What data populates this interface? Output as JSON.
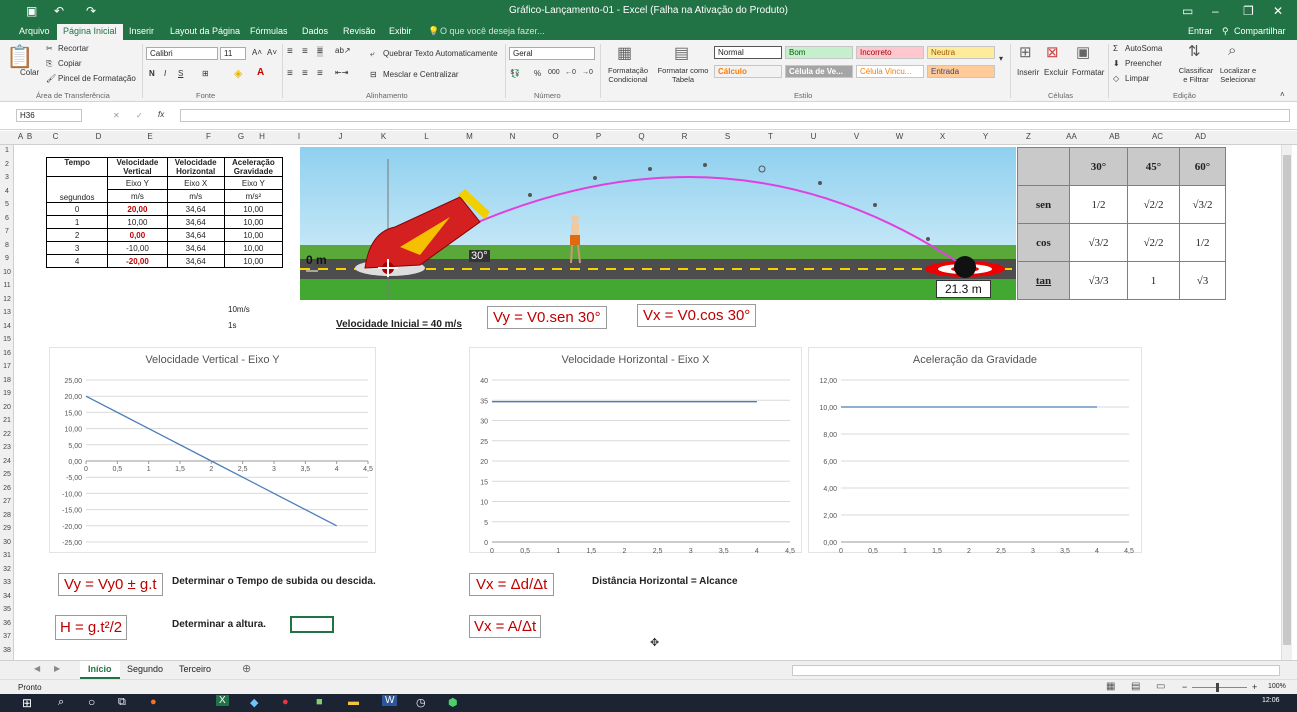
{
  "window": {
    "title": "Gráfico-Lançamento-01 - Excel (Falha na Ativação do Produto)",
    "sign_in": "Entrar",
    "share": "Compartilhar"
  },
  "ribbon_tabs": [
    "Arquivo",
    "Página Inicial",
    "Inserir",
    "Layout da Página",
    "Fórmulas",
    "Dados",
    "Revisão",
    "Exibir"
  ],
  "tell_me": "O que você deseja fazer...",
  "ribbon": {
    "clipboard": {
      "paste": "Colar",
      "cut": "Recortar",
      "copy": "Copiar",
      "format_painter": "Pincel de Formatação",
      "group": "Área de Transferência"
    },
    "font": {
      "name": "Calibri",
      "size": "11",
      "bold": "N",
      "italic": "I",
      "underline": "S",
      "group": "Fonte"
    },
    "alignment": {
      "wrap": "Quebrar Texto Automaticamente",
      "merge": "Mesclar e Centralizar",
      "group": "Alinhamento"
    },
    "number": {
      "format": "Geral",
      "group": "Número",
      "percent": "%",
      "thousands": "000"
    },
    "styles": {
      "cond": "Formatação Condicional",
      "table": "Formatar como Tabela",
      "normal": "Normal",
      "good": "Bom",
      "bad": "Incorreto",
      "neutral": "Neutra",
      "calc": "Cálculo",
      "check": "Célula de Ve...",
      "linked": "Célula Vincu...",
      "input": "Entrada",
      "group": "Estilo"
    },
    "cells": {
      "insert": "Inserir",
      "delete": "Excluir",
      "format": "Formatar",
      "group": "Células"
    },
    "editing": {
      "autosum": "AutoSoma",
      "fill": "Preencher",
      "clear": "Limpar",
      "sort": "Classificar e Filtrar",
      "find": "Localizar e Selecionar",
      "group": "Edição"
    }
  },
  "formula_bar": {
    "name_box": "H36",
    "fx": "fx",
    "content": ""
  },
  "columns": [
    "A",
    "B",
    "C",
    "D",
    "E",
    "F",
    "G",
    "H",
    "I",
    "J",
    "K",
    "L",
    "M",
    "N",
    "O",
    "P",
    "Q",
    "R",
    "S",
    "T",
    "U",
    "V",
    "W",
    "X",
    "Y",
    "Z",
    "AA",
    "AB",
    "AC",
    "AD"
  ],
  "rows": [
    "1",
    "2",
    "3",
    "4",
    "5",
    "6",
    "7",
    "8",
    "9",
    "10",
    "11",
    "12",
    "13",
    "14",
    "15",
    "16",
    "17",
    "18",
    "19",
    "20",
    "21",
    "22",
    "23",
    "24",
    "25",
    "26",
    "27",
    "28",
    "29",
    "30",
    "31",
    "32",
    "33",
    "34",
    "35",
    "36",
    "37",
    "38"
  ],
  "data_table": {
    "headers": [
      "Tempo",
      "Velocidade Vertical",
      "Velocidade Horizontal",
      "Aceleração Gravidade"
    ],
    "sub": [
      "",
      "Eixo Y",
      "Eixo X",
      "Eixo Y"
    ],
    "units": [
      "segundos",
      "m/s",
      "m/s",
      "m/s²"
    ],
    "rows": [
      [
        "0",
        "20,00",
        "34,64",
        "10,00"
      ],
      [
        "1",
        "10,00",
        "34,64",
        "10,00"
      ],
      [
        "2",
        "0,00",
        "34,64",
        "10,00"
      ],
      [
        "3",
        "-10,00",
        "34,64",
        "10,00"
      ],
      [
        "4",
        "-20,00",
        "34,64",
        "10,00"
      ]
    ]
  },
  "notes": {
    "speed": "10m/s",
    "time": "1s",
    "initial": "Velocidade Inicial = 40 m/s"
  },
  "image": {
    "zero_label": "0 m",
    "angle": "30°",
    "distance": "21.3 m"
  },
  "trig": {
    "headers": [
      "30°",
      "45°",
      "60°"
    ],
    "rows": [
      "sen",
      "cos",
      "tan"
    ],
    "values": [
      [
        "1/2",
        "√2/2",
        "√3/2"
      ],
      [
        "√3/2",
        "√2/2",
        "1/2"
      ],
      [
        "√3/3",
        "1",
        "√3"
      ]
    ]
  },
  "equations": {
    "vy": "Vy = V0.sen 30°",
    "vx": "Vx = V0.cos 30°",
    "vy_t": "Vy = Vy0 ± g.t",
    "h": "H = g.t²/2",
    "vx_d": "Vx = Δd/Δt",
    "vx_a": "Vx = A/Δt"
  },
  "labels": {
    "tempo": "Determinar o Tempo de subida ou descida.",
    "altura": "Determinar a altura.",
    "alcance": "Distância Horizontal = Alcance"
  },
  "chart_data": [
    {
      "type": "line",
      "title": "Velocidade Vertical - Eixo Y",
      "x": [
        0,
        1,
        2,
        3,
        4
      ],
      "series": [
        {
          "values": [
            20,
            10,
            0,
            -10,
            -20
          ]
        }
      ],
      "xlim": [
        0,
        4.5
      ],
      "ylim": [
        -25,
        25
      ],
      "xticks": [
        "0",
        "0,5",
        "1",
        "1,5",
        "2",
        "2,5",
        "3",
        "3,5",
        "4",
        "4,5"
      ],
      "yticks": [
        "25,00",
        "20,00",
        "15,00",
        "10,00",
        "5,00",
        "0,00",
        "-5,00",
        "-10,00",
        "-15,00",
        "-20,00",
        "-25,00"
      ],
      "color": "#4a7ebb"
    },
    {
      "type": "line",
      "title": "Velocidade Horizontal - Eixo X",
      "x": [
        0,
        1,
        2,
        3,
        4
      ],
      "series": [
        {
          "values": [
            34.64,
            34.64,
            34.64,
            34.64,
            34.64
          ]
        }
      ],
      "xlim": [
        0,
        4.5
      ],
      "ylim": [
        0,
        40
      ],
      "xticks": [
        "0",
        "0,5",
        "1",
        "1,5",
        "2",
        "2,5",
        "3",
        "3,5",
        "4",
        "4,5"
      ],
      "yticks": [
        "40",
        "35",
        "30",
        "25",
        "20",
        "15",
        "10",
        "5",
        "0"
      ],
      "color": "#4a7ebb"
    },
    {
      "type": "line",
      "title": "Aceleração da Gravidade",
      "x": [
        0,
        1,
        2,
        3,
        4
      ],
      "series": [
        {
          "values": [
            10,
            10,
            10,
            10,
            10
          ]
        }
      ],
      "xlim": [
        0,
        4.5
      ],
      "ylim": [
        0,
        12
      ],
      "xticks": [
        "0",
        "0,5",
        "1",
        "1,5",
        "2",
        "2,5",
        "3",
        "3,5",
        "4",
        "4,5"
      ],
      "yticks": [
        "12,00",
        "10,00",
        "8,00",
        "6,00",
        "4,00",
        "2,00",
        "0,00"
      ],
      "color": "#4a7ebb"
    }
  ],
  "sheets": [
    "Início",
    "Segundo",
    "Terceiro"
  ],
  "status": {
    "ready": "Pronto",
    "zoom": "100%"
  },
  "clock": {
    "time": "12:06"
  }
}
